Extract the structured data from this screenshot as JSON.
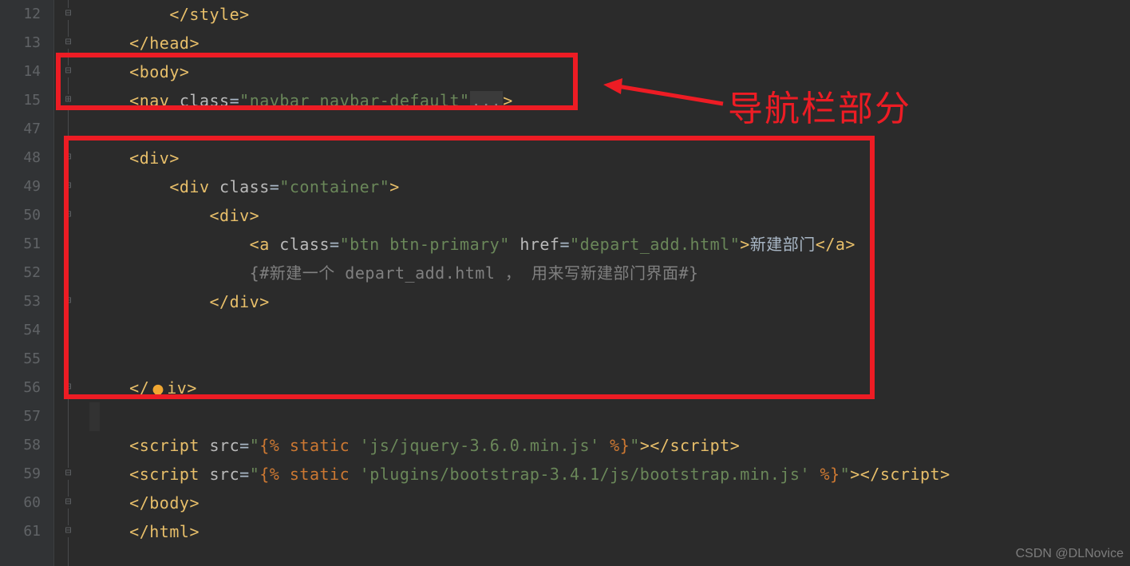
{
  "gutter": {
    "lines": [
      "12",
      "13",
      "14",
      "15",
      "47",
      "48",
      "49",
      "50",
      "51",
      "52",
      "53",
      "54",
      "55",
      "56",
      "57",
      "58",
      "59",
      "60",
      "61"
    ]
  },
  "code": {
    "l12_indent": "        ",
    "l12_close_style_open": "</",
    "l12_close_style_name": "style",
    "l12_close_style_end": ">",
    "l13_indent": "    ",
    "l13_open": "</",
    "l13_name": "head",
    "l13_end": ">",
    "l14_indent": "    ",
    "l14_open": "<",
    "l14_name": "body",
    "l14_end": ">",
    "l15_indent": "    ",
    "l15_open": "<",
    "l15_name": "nav ",
    "l15_attr": "class",
    "l15_eq": "=",
    "l15_val": "\"navbar navbar-default\"",
    "l15_fold": "...",
    "l15_end": ">",
    "l48_indent": "    ",
    "l48_open": "<",
    "l48_name": "div",
    "l48_end": ">",
    "l49_indent": "        ",
    "l49_open": "<",
    "l49_name": "div ",
    "l49_attr": "class",
    "l49_eq": "=",
    "l49_val": "\"container\"",
    "l49_end": ">",
    "l50_indent": "            ",
    "l50_open": "<",
    "l50_name": "div",
    "l50_end": ">",
    "l51_indent": "                ",
    "l51_open": "<",
    "l51_name": "a ",
    "l51_attr1": "class",
    "l51_eq": "=",
    "l51_val1": "\"btn btn-primary\"",
    "l51_sp": " ",
    "l51_attr2": "href",
    "l51_val2": "\"depart_add.html\"",
    "l51_end": ">",
    "l51_text": "新建部门",
    "l51_close_open": "</",
    "l51_close_name": "a",
    "l51_close_end": ">",
    "l52_indent": "                ",
    "l52_cmt": "{#新建一个 depart_add.html ， 用来写新建部门界面#}",
    "l53_indent": "            ",
    "l53_open": "</",
    "l53_name": "div",
    "l53_end": ">",
    "l56_indent": "    ",
    "l56_open": "</",
    "l56_pre": "d",
    "l56_post": "iv",
    "l56_end": ">",
    "l58_indent": "    ",
    "l58_open": "<",
    "l58_name": "script ",
    "l58_attr": "src",
    "l58_eq": "=",
    "l58_val_q1": "\"",
    "l58_tpl1": "{% ",
    "l58_static": "static ",
    "l58_path": "'js/jquery-3.6.0.min.js'",
    "l58_tpl2": " %}",
    "l58_val_q2": "\"",
    "l58_end1": ">",
    "l58_close_open": "</",
    "l58_close_name": "script",
    "l58_close_end": ">",
    "l59_indent": "    ",
    "l59_open": "<",
    "l59_name": "script ",
    "l59_attr": "src",
    "l59_eq": "=",
    "l59_val_q1": "\"",
    "l59_tpl1": "{% ",
    "l59_static": "static ",
    "l59_path": "'plugins/bootstrap-3.4.1/js/bootstrap.min.js'",
    "l59_tpl2": " %}",
    "l59_val_q2": "\"",
    "l59_end1": ">",
    "l59_close_open": "</",
    "l59_close_name": "script",
    "l59_close_end": ">",
    "l60_indent": "    ",
    "l60_open": "</",
    "l60_name": "body",
    "l60_end": ">",
    "l61_indent": "    ",
    "l61_open": "</",
    "l61_name": "html",
    "l61_end": ">"
  },
  "annotation": "导航栏部分",
  "watermark": "CSDN @DLNovice"
}
